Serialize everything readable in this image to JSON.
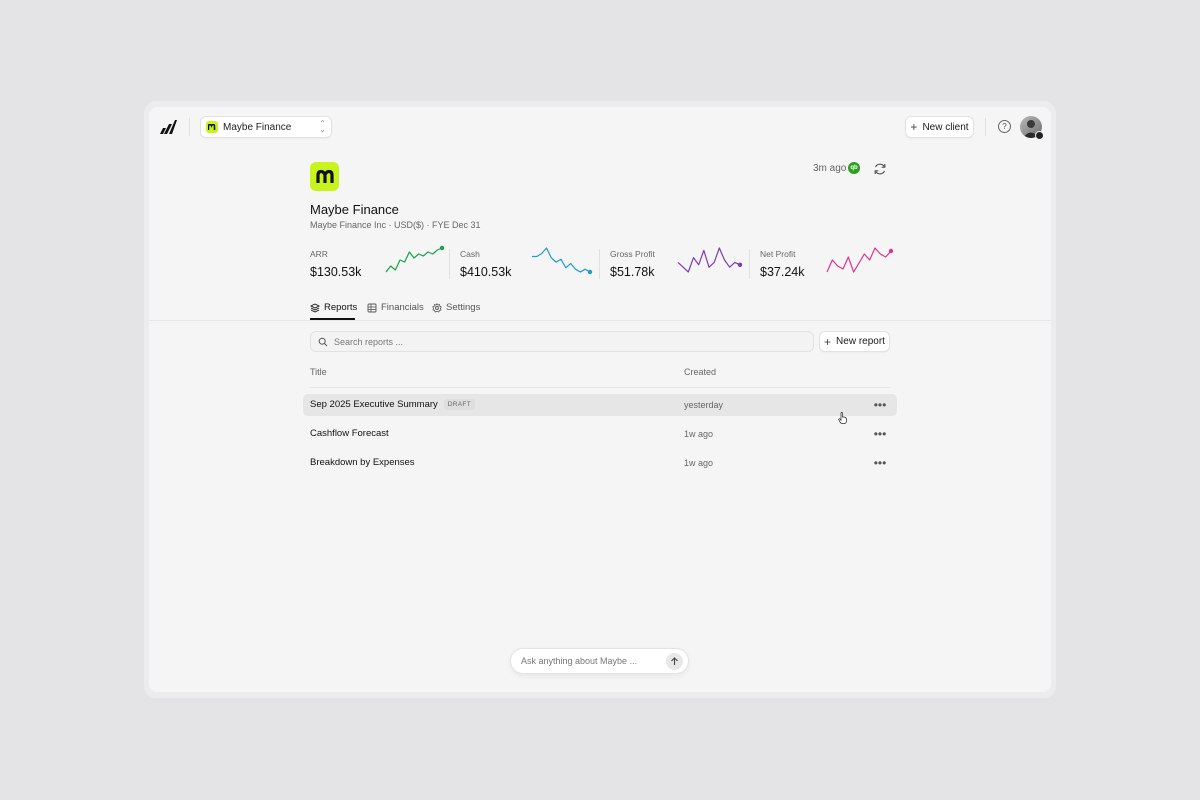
{
  "org_switcher": {
    "name": "Maybe Finance",
    "icon": "maybe-logo-icon"
  },
  "header_actions": {
    "new_client_label": "New client",
    "help_icon": "help-circle-icon"
  },
  "client": {
    "name": "Maybe Finance",
    "subtitle": "Maybe Finance Inc · USD($) · FYE Dec 31",
    "sync_time": "3m ago",
    "sync_source_badge": "qb"
  },
  "metrics": [
    {
      "label": "ARR",
      "value": "$130.53k",
      "color": "#16a34a",
      "trend": [
        6,
        9,
        7,
        12,
        11,
        16,
        13,
        15,
        14,
        16,
        15,
        17,
        18
      ]
    },
    {
      "label": "Cash",
      "value": "$410.53k",
      "color": "#1d9bd1",
      "trend": [
        16,
        16,
        18,
        22,
        15,
        12,
        14,
        8,
        11,
        7,
        5,
        7,
        5
      ]
    },
    {
      "label": "Gross Profit",
      "value": "$51.78k",
      "color": "#7e3ab8",
      "trend": [
        10,
        8,
        6,
        12,
        9,
        15,
        8,
        10,
        16,
        11,
        8,
        10,
        9
      ]
    },
    {
      "label": "Net Profit",
      "value": "$37.24k",
      "color": "#e0338e",
      "trend": [
        8,
        12,
        10,
        9,
        13,
        8,
        11,
        14,
        12,
        16,
        14,
        13,
        15
      ]
    }
  ],
  "tabs": [
    {
      "label": "Reports",
      "icon": "layers-icon",
      "active": true
    },
    {
      "label": "Financials",
      "icon": "table-icon",
      "active": false
    },
    {
      "label": "Settings",
      "icon": "gear-icon",
      "active": false
    }
  ],
  "search": {
    "placeholder": "Search reports ..."
  },
  "new_report_label": "New report",
  "table": {
    "columns": [
      "Title",
      "Created"
    ],
    "rows": [
      {
        "title": "Sep 2025 Executive Summary",
        "badge": "DRAFT",
        "created": "yesterday"
      },
      {
        "title": "Cashflow Forecast",
        "badge": "",
        "created": "1w ago"
      },
      {
        "title": "Breakdown by Expenses",
        "badge": "",
        "created": "1w ago"
      }
    ]
  },
  "ask": {
    "placeholder": "Ask anything about Maybe ..."
  }
}
